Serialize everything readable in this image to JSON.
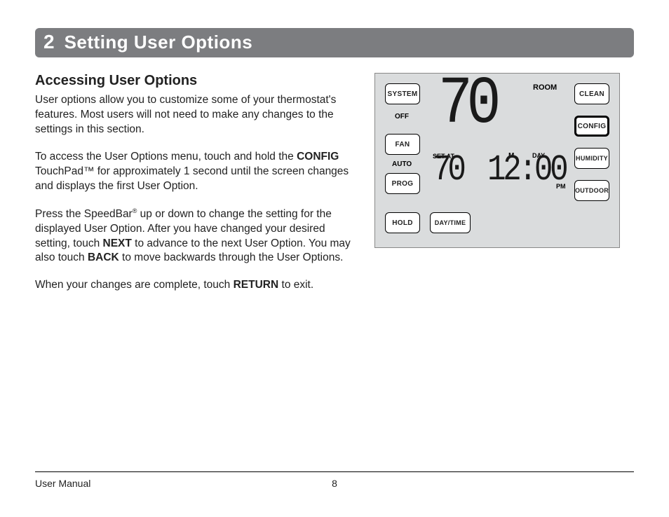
{
  "chapter": {
    "number": "2",
    "title": "Setting User Options"
  },
  "section": {
    "heading": "Accessing User Options"
  },
  "paragraphs": {
    "p1": "User options allow you to customize some of your thermostat's features. Most users will not need to make any changes to the settings in this section.",
    "p2a": "To access the User Options menu, touch and hold the ",
    "p2b": "CONFIG",
    "p2c": " TouchPad™ for approximately 1 second until the screen changes and displays the first User Option.",
    "p3a": "Press the SpeedBar",
    "p3sup": "®",
    "p3b": " up or down to change the setting for the displayed User Option. After you have changed your desired setting, touch ",
    "p3c": "NEXT",
    "p3d": " to advance to the next User Option. You may also touch ",
    "p3e": "BACK",
    "p3f": " to move backwards through the User Options.",
    "p4a": "When your changes are complete, touch ",
    "p4b": "RETURN",
    "p4c": " to exit."
  },
  "thermostat": {
    "buttons": {
      "system": "SYSTEM",
      "fan": "FAN",
      "prog": "PROG",
      "hold": "HOLD",
      "daytime": "DAY/TIME",
      "clean": "CLEAN",
      "config": "CONFIG",
      "humidity": "HUMIDITY",
      "outdoor": "OUTDOOR"
    },
    "labels": {
      "off": "OFF",
      "auto": "AUTO",
      "room": "ROOM",
      "setat": "SET AT",
      "m": "M",
      "day": "DAY",
      "pm": "PM"
    },
    "display": {
      "main_temp": "70",
      "set_temp": "70",
      "time": "12:00"
    }
  },
  "footer": {
    "left": "User Manual",
    "page": "8"
  }
}
